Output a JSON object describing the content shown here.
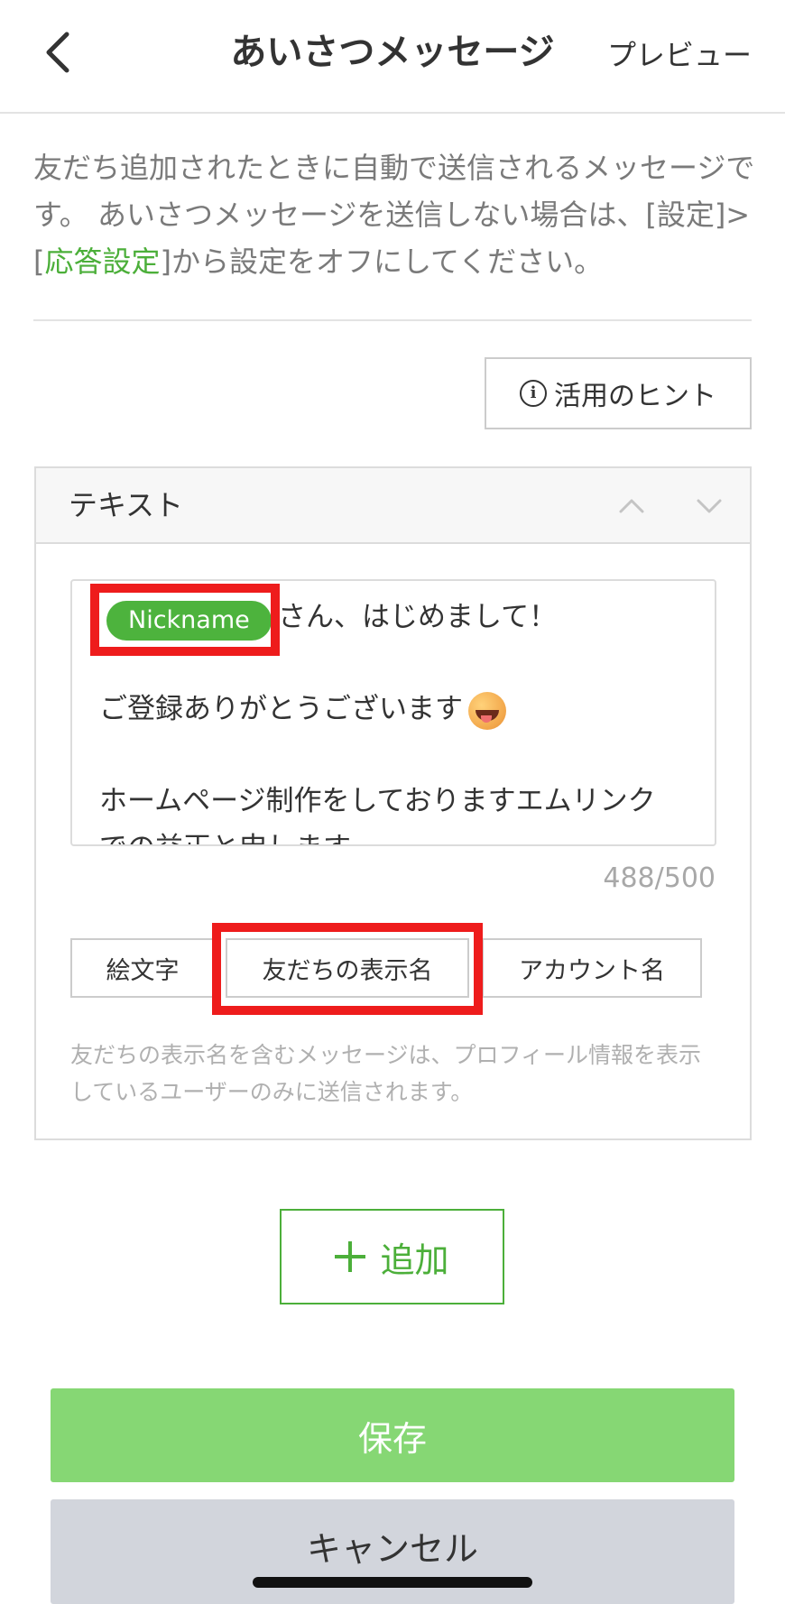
{
  "header": {
    "title": "あいさつメッセージ",
    "preview_label": "プレビュー"
  },
  "description": {
    "part1": "友だち追加されたときに自動で送信されるメッセージです。 あいさつメッセージを送信しない場合は、[設定]>[",
    "link": "応答設定",
    "part2": "]から設定をオフにしてください。"
  },
  "hint_button": {
    "label": "活用のヒント"
  },
  "card": {
    "title": "テキスト",
    "message": {
      "nickname_chip": "Nickname",
      "line1_suffix": "さん、はじめまして！",
      "line2": "ご登録ありがとうございます",
      "line3": "ホームページ制作をしておりますエムリンク",
      "line4_partial": "での益正と申します。"
    },
    "counter": "488/500",
    "insert_buttons": {
      "emoji": "絵文字",
      "friend_name": "友だちの表示名",
      "account_name": "アカウント名"
    },
    "note": "友だちの表示名を含むメッセージは、プロフィール情報を表示しているユーザーのみに送信されます。"
  },
  "add_button": {
    "label": "追加"
  },
  "footer": {
    "save_label": "保存",
    "cancel_label": "キャンセル"
  },
  "colors": {
    "accent_green": "#4caf3a",
    "save_green": "#86d774",
    "highlight_red": "#ee1c1c",
    "cancel_gray": "#d2d5dc"
  },
  "icons": {
    "back": "chevron-left-icon",
    "info": "info-icon",
    "move_up": "chevron-up-icon",
    "move_down": "chevron-down-icon",
    "add": "plus-icon",
    "emoji": "grinning-face-emoji"
  }
}
